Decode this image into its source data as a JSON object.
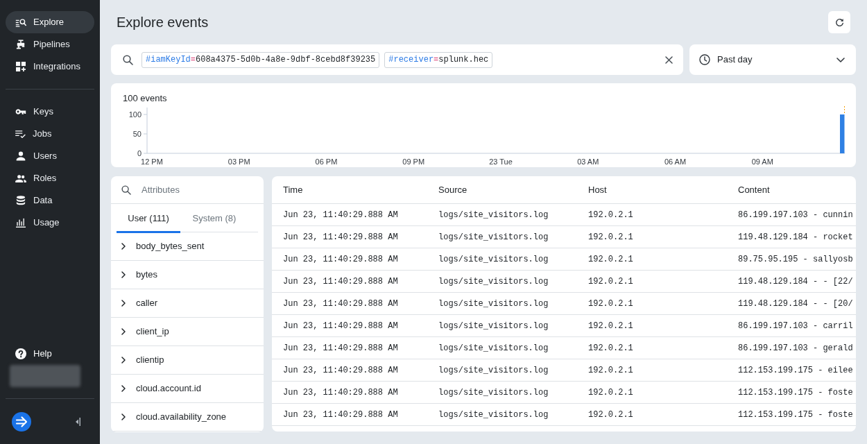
{
  "sidebar": {
    "primary_items": [
      {
        "label": "Explore",
        "selected": true
      },
      {
        "label": "Pipelines",
        "selected": false
      },
      {
        "label": "Integrations",
        "selected": false
      }
    ],
    "secondary_items": [
      {
        "label": "Keys",
        "selected": false
      },
      {
        "label": "Jobs",
        "selected": false
      },
      {
        "label": "Users",
        "selected": false
      },
      {
        "label": "Roles",
        "selected": false
      },
      {
        "label": "Data",
        "selected": false
      },
      {
        "label": "Usage",
        "selected": false
      }
    ],
    "help": {
      "label": "Help"
    }
  },
  "page": {
    "title": "Explore events"
  },
  "search": {
    "tokens": [
      {
        "key": "#iamKeyId",
        "operator": "=",
        "value": "608a4375-5d0b-4a8e-9dbf-8cebd8f39235"
      },
      {
        "key": "#receiver",
        "operator": "=",
        "value": "splunk.hec"
      }
    ]
  },
  "time_range": {
    "value": "Past day"
  },
  "histogram": {
    "chart_data": {
      "type": "bar",
      "title": "100 events",
      "ylim": [
        0,
        100
      ],
      "yticks": [
        0,
        50,
        100
      ],
      "categories": [
        null,
        "12 PM",
        null,
        null,
        null,
        null,
        null,
        null,
        null,
        null,
        null,
        null,
        null,
        null,
        null,
        null,
        null,
        null,
        null,
        "03 PM",
        null,
        null,
        null,
        null,
        null,
        null,
        null,
        null,
        null,
        null,
        null,
        null,
        null,
        null,
        null,
        null,
        null,
        "06 PM",
        null,
        null,
        null,
        null,
        null,
        null,
        null,
        null,
        null,
        null,
        null,
        null,
        null,
        null,
        null,
        null,
        null,
        "09 PM",
        null,
        null,
        null,
        null,
        null,
        null,
        null,
        null,
        null,
        null,
        null,
        null,
        null,
        null,
        null,
        null,
        null,
        "23 Tue",
        null,
        null,
        null,
        null,
        null,
        null,
        null,
        null,
        null,
        null,
        null,
        null,
        null,
        null,
        null,
        null,
        null,
        "03 AM",
        null,
        null,
        null,
        null,
        null,
        null,
        null,
        null,
        null,
        null,
        null,
        null,
        null,
        null,
        null,
        null,
        null,
        "06 AM",
        null,
        null,
        null,
        null,
        null,
        null,
        null,
        null,
        null,
        null,
        null,
        null,
        null,
        null,
        null,
        null,
        null,
        "09 AM",
        null,
        null,
        null,
        null,
        null,
        null,
        null,
        null,
        null,
        null,
        null,
        null,
        null,
        null,
        null,
        null
      ],
      "values": [
        0,
        0,
        0,
        0,
        0,
        0,
        0,
        0,
        0,
        0,
        0,
        0,
        0,
        0,
        0,
        0,
        0,
        0,
        0,
        0,
        0,
        0,
        0,
        0,
        0,
        0,
        0,
        0,
        0,
        0,
        0,
        0,
        0,
        0,
        0,
        0,
        0,
        0,
        0,
        0,
        0,
        0,
        0,
        0,
        0,
        0,
        0,
        0,
        0,
        0,
        0,
        0,
        0,
        0,
        0,
        0,
        0,
        0,
        0,
        0,
        0,
        0,
        0,
        0,
        0,
        0,
        0,
        0,
        0,
        0,
        0,
        0,
        0,
        0,
        0,
        0,
        0,
        0,
        0,
        0,
        0,
        0,
        0,
        0,
        0,
        0,
        0,
        0,
        0,
        0,
        0,
        0,
        0,
        0,
        0,
        0,
        0,
        0,
        0,
        0,
        0,
        0,
        0,
        0,
        0,
        0,
        0,
        0,
        0,
        0,
        0,
        0,
        0,
        0,
        0,
        0,
        0,
        0,
        0,
        0,
        0,
        0,
        0,
        0,
        0,
        0,
        0,
        0,
        0,
        0,
        0,
        0,
        0,
        0,
        0,
        0,
        0,
        0,
        0,
        0,
        0,
        0,
        0,
        100
      ]
    }
  },
  "attributes": {
    "search": {
      "placeholder": "Attributes"
    },
    "tabs": [
      {
        "label": "User (111)",
        "selected": true
      },
      {
        "label": "System (8)",
        "selected": false
      }
    ],
    "items": [
      "body_bytes_sent",
      "bytes",
      "caller",
      "client_ip",
      "clientip",
      "cloud.account.id",
      "cloud.availability_zone"
    ]
  },
  "events_table": {
    "columns": [
      "Time",
      "Source",
      "Host",
      "Content"
    ],
    "rows": [
      [
        "Jun 23, 11:40:29.888 AM",
        "logs/site_visitors.log",
        "192.0.2.1",
        "86.199.197.103 - cunnin"
      ],
      [
        "Jun 23, 11:40:29.888 AM",
        "logs/site_visitors.log",
        "192.0.2.1",
        "119.48.129.184 - rocket"
      ],
      [
        "Jun 23, 11:40:29.888 AM",
        "logs/site_visitors.log",
        "192.0.2.1",
        "89.75.95.195 - sallyosb"
      ],
      [
        "Jun 23, 11:40:29.888 AM",
        "logs/site_visitors.log",
        "192.0.2.1",
        "119.48.129.184 - - [22/"
      ],
      [
        "Jun 23, 11:40:29.888 AM",
        "logs/site_visitors.log",
        "192.0.2.1",
        "119.48.129.184 - - [20/"
      ],
      [
        "Jun 23, 11:40:29.888 AM",
        "logs/site_visitors.log",
        "192.0.2.1",
        "86.199.197.103 - carril"
      ],
      [
        "Jun 23, 11:40:29.888 AM",
        "logs/site_visitors.log",
        "192.0.2.1",
        "86.199.197.103 - gerald"
      ],
      [
        "Jun 23, 11:40:29.888 AM",
        "logs/site_visitors.log",
        "192.0.2.1",
        "112.153.199.175 - eilee"
      ],
      [
        "Jun 23, 11:40:29.888 AM",
        "logs/site_visitors.log",
        "192.0.2.1",
        "112.153.199.175 - foste"
      ],
      [
        "Jun 23, 11:40:29.888 AM",
        "logs/site_visitors.log",
        "192.0.2.1",
        "112.153.199.175 - foste"
      ]
    ]
  }
}
